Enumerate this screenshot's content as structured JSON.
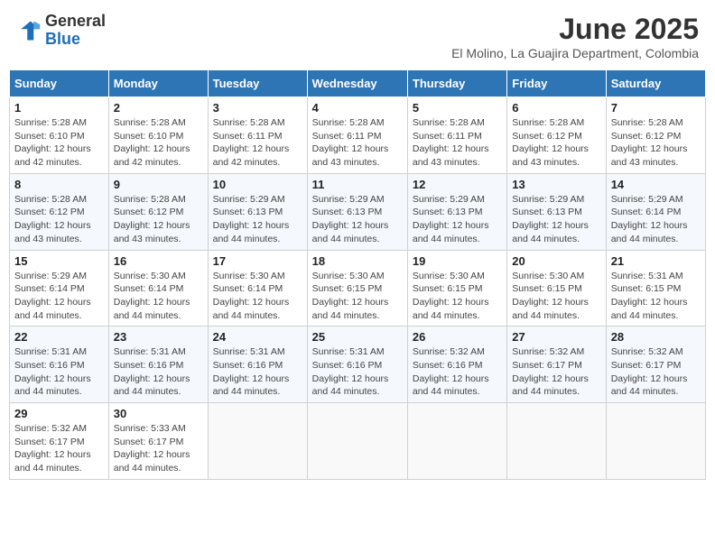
{
  "header": {
    "logo_general": "General",
    "logo_blue": "Blue",
    "month_year": "June 2025",
    "location": "El Molino, La Guajira Department, Colombia"
  },
  "days_of_week": [
    "Sunday",
    "Monday",
    "Tuesday",
    "Wednesday",
    "Thursday",
    "Friday",
    "Saturday"
  ],
  "weeks": [
    [
      {
        "day": "1",
        "sunrise": "5:28 AM",
        "sunset": "6:10 PM",
        "daylight": "12 hours and 42 minutes."
      },
      {
        "day": "2",
        "sunrise": "5:28 AM",
        "sunset": "6:10 PM",
        "daylight": "12 hours and 42 minutes."
      },
      {
        "day": "3",
        "sunrise": "5:28 AM",
        "sunset": "6:11 PM",
        "daylight": "12 hours and 42 minutes."
      },
      {
        "day": "4",
        "sunrise": "5:28 AM",
        "sunset": "6:11 PM",
        "daylight": "12 hours and 43 minutes."
      },
      {
        "day": "5",
        "sunrise": "5:28 AM",
        "sunset": "6:11 PM",
        "daylight": "12 hours and 43 minutes."
      },
      {
        "day": "6",
        "sunrise": "5:28 AM",
        "sunset": "6:12 PM",
        "daylight": "12 hours and 43 minutes."
      },
      {
        "day": "7",
        "sunrise": "5:28 AM",
        "sunset": "6:12 PM",
        "daylight": "12 hours and 43 minutes."
      }
    ],
    [
      {
        "day": "8",
        "sunrise": "5:28 AM",
        "sunset": "6:12 PM",
        "daylight": "12 hours and 43 minutes."
      },
      {
        "day": "9",
        "sunrise": "5:28 AM",
        "sunset": "6:12 PM",
        "daylight": "12 hours and 43 minutes."
      },
      {
        "day": "10",
        "sunrise": "5:29 AM",
        "sunset": "6:13 PM",
        "daylight": "12 hours and 44 minutes."
      },
      {
        "day": "11",
        "sunrise": "5:29 AM",
        "sunset": "6:13 PM",
        "daylight": "12 hours and 44 minutes."
      },
      {
        "day": "12",
        "sunrise": "5:29 AM",
        "sunset": "6:13 PM",
        "daylight": "12 hours and 44 minutes."
      },
      {
        "day": "13",
        "sunrise": "5:29 AM",
        "sunset": "6:13 PM",
        "daylight": "12 hours and 44 minutes."
      },
      {
        "day": "14",
        "sunrise": "5:29 AM",
        "sunset": "6:14 PM",
        "daylight": "12 hours and 44 minutes."
      }
    ],
    [
      {
        "day": "15",
        "sunrise": "5:29 AM",
        "sunset": "6:14 PM",
        "daylight": "12 hours and 44 minutes."
      },
      {
        "day": "16",
        "sunrise": "5:30 AM",
        "sunset": "6:14 PM",
        "daylight": "12 hours and 44 minutes."
      },
      {
        "day": "17",
        "sunrise": "5:30 AM",
        "sunset": "6:14 PM",
        "daylight": "12 hours and 44 minutes."
      },
      {
        "day": "18",
        "sunrise": "5:30 AM",
        "sunset": "6:15 PM",
        "daylight": "12 hours and 44 minutes."
      },
      {
        "day": "19",
        "sunrise": "5:30 AM",
        "sunset": "6:15 PM",
        "daylight": "12 hours and 44 minutes."
      },
      {
        "day": "20",
        "sunrise": "5:30 AM",
        "sunset": "6:15 PM",
        "daylight": "12 hours and 44 minutes."
      },
      {
        "day": "21",
        "sunrise": "5:31 AM",
        "sunset": "6:15 PM",
        "daylight": "12 hours and 44 minutes."
      }
    ],
    [
      {
        "day": "22",
        "sunrise": "5:31 AM",
        "sunset": "6:16 PM",
        "daylight": "12 hours and 44 minutes."
      },
      {
        "day": "23",
        "sunrise": "5:31 AM",
        "sunset": "6:16 PM",
        "daylight": "12 hours and 44 minutes."
      },
      {
        "day": "24",
        "sunrise": "5:31 AM",
        "sunset": "6:16 PM",
        "daylight": "12 hours and 44 minutes."
      },
      {
        "day": "25",
        "sunrise": "5:31 AM",
        "sunset": "6:16 PM",
        "daylight": "12 hours and 44 minutes."
      },
      {
        "day": "26",
        "sunrise": "5:32 AM",
        "sunset": "6:16 PM",
        "daylight": "12 hours and 44 minutes."
      },
      {
        "day": "27",
        "sunrise": "5:32 AM",
        "sunset": "6:17 PM",
        "daylight": "12 hours and 44 minutes."
      },
      {
        "day": "28",
        "sunrise": "5:32 AM",
        "sunset": "6:17 PM",
        "daylight": "12 hours and 44 minutes."
      }
    ],
    [
      {
        "day": "29",
        "sunrise": "5:32 AM",
        "sunset": "6:17 PM",
        "daylight": "12 hours and 44 minutes."
      },
      {
        "day": "30",
        "sunrise": "5:33 AM",
        "sunset": "6:17 PM",
        "daylight": "12 hours and 44 minutes."
      },
      null,
      null,
      null,
      null,
      null
    ]
  ],
  "labels": {
    "sunrise": "Sunrise:",
    "sunset": "Sunset:",
    "daylight": "Daylight:"
  }
}
